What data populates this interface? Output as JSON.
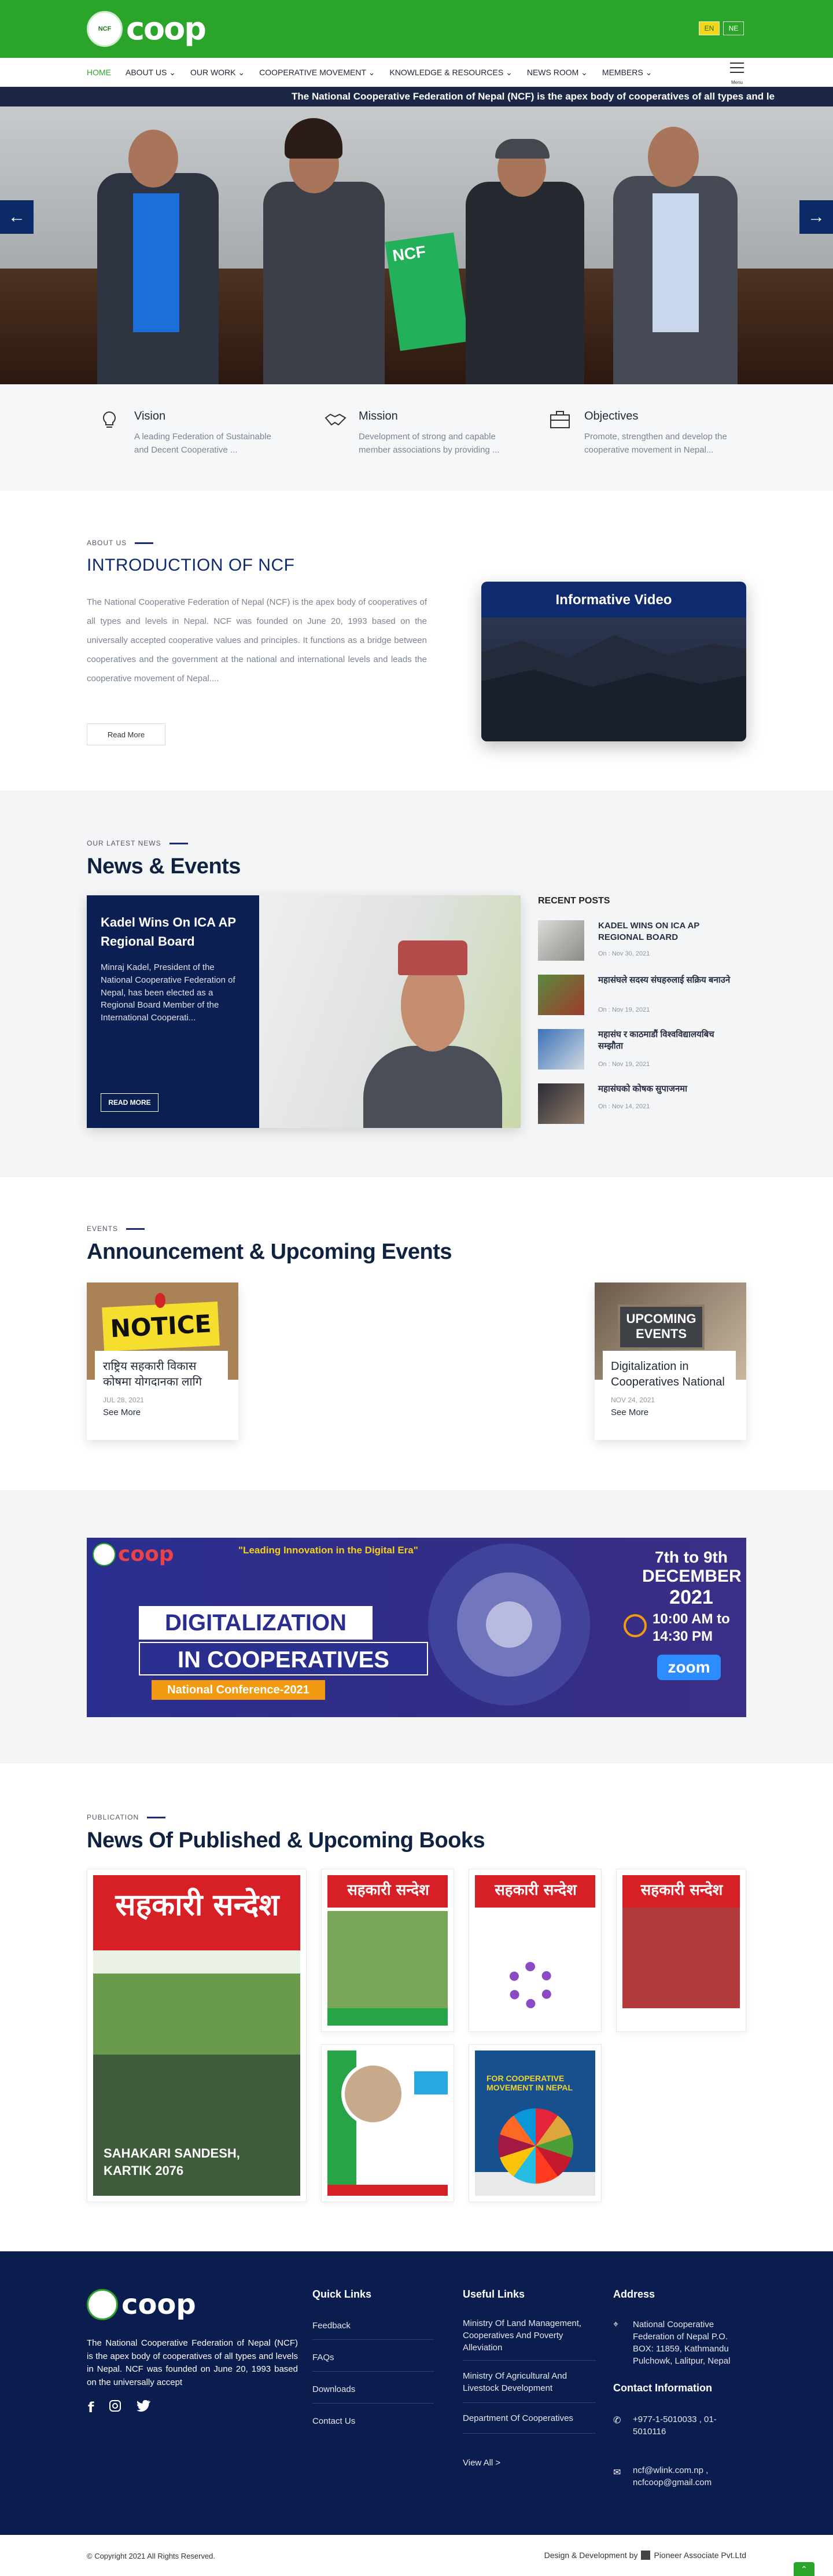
{
  "header": {
    "logo_seal_text": "NCF",
    "logo_text": "coop",
    "languages": [
      {
        "code": "EN",
        "active": true
      },
      {
        "code": "NE",
        "active": false
      }
    ],
    "nav": [
      {
        "label": "HOME",
        "active": true
      },
      {
        "label": "ABOUT US",
        "dropdown": true
      },
      {
        "label": "OUR WORK",
        "dropdown": true
      },
      {
        "label": "COOPERATIVE MOVEMENT",
        "dropdown": true
      },
      {
        "label": "KNOWLEDGE & RESOURCES",
        "dropdown": true
      },
      {
        "label": "NEWS ROOM",
        "dropdown": true
      },
      {
        "label": "MEMBERS",
        "dropdown": true
      }
    ],
    "menu_label": "Menu",
    "ticker": "The National Cooperative Federation of Nepal (NCF) is the apex body of cooperatives of all types and le"
  },
  "hero": {
    "prev_icon": "arrow-left-icon",
    "next_icon": "arrow-right-icon",
    "book_label": "NCF"
  },
  "vmo": [
    {
      "title": "Vision",
      "text": "A leading Federation of Sustainable and Decent Cooperative ...",
      "icon": "lightbulb-icon"
    },
    {
      "title": "Mission",
      "text": "Development of strong and capable member associations by providing ...",
      "icon": "handshake-icon"
    },
    {
      "title": "Objectives",
      "text": "Promote, strengthen and develop the cooperative movement in Nepal...",
      "icon": "briefcase-icon"
    }
  ],
  "about": {
    "eyebrow": "ABOUT US",
    "title": "INTRODUCTION OF NCF",
    "text": "The National Cooperative Federation of Nepal (NCF) is the apex body of cooperatives of all types and levels in Nepal. NCF was founded on June 20, 1993 based on the universally accepted cooperative values and principles. It functions as a bridge between cooperatives and the government at the national and international levels and leads the cooperative movement of Nepal....",
    "button": "Read More",
    "video_title": "Informative Video"
  },
  "news": {
    "eyebrow": "OUR LATEST NEWS",
    "title": "News & Events",
    "feature": {
      "title": "Kadel Wins On ICA AP Regional Board",
      "text": "Minraj Kadel, President of the National Cooperative Federation of Nepal, has been elected as a Regional Board Member of the International Cooperati...",
      "button": "READ MORE"
    },
    "recent_heading": "RECENT POSTS",
    "recent": [
      {
        "title": "KADEL WINS ON ICA AP REGIONAL BOARD",
        "date": "On : Nov 30, 2021"
      },
      {
        "title": "महासंघले सदस्य संघहरुलाई सक्रिय बनाउने",
        "date": "On : Nov 19, 2021"
      },
      {
        "title": "महासंघ र काठमाडौं विश्वविद्यालयबिच सम्झौता",
        "date": "On : Nov 19, 2021"
      },
      {
        "title": "महासंघको कोषक सुपाजनमा",
        "date": "On : Nov 14, 2021"
      }
    ]
  },
  "events": {
    "eyebrow": "EVENTS",
    "title": "Announcement & Upcoming Events",
    "items": [
      {
        "image_text": "NOTICE",
        "title": "राष्ट्रिय सहकारी विकास कोषमा योगदानका लागि",
        "date": "JUL 28, 2021",
        "more": "See More"
      },
      {
        "image_text": "UPCOMING EVENTS",
        "title": "Digitalization in Cooperatives National",
        "date": "NOV 24, 2021",
        "more": "See More"
      }
    ]
  },
  "banner": {
    "logo_text": "coop",
    "tagline": "\"Leading Innovation in the Digital Era\"",
    "line1": "DIGITALIZATION",
    "line2": "IN COOPERATIVES",
    "conf": "National Conference-2021",
    "dates": "7th to 9th",
    "month": "DECEMBER",
    "year": "2021",
    "time": "10:00 AM to 14:30 PM",
    "platform": "zoom",
    "colors": {
      "navy": "#2a2f8f",
      "orange": "#f29a12",
      "white": "#ffffff"
    }
  },
  "publication": {
    "eyebrow": "PUBLICATION",
    "title": "News Of Published & Upcoming Books",
    "featured": {
      "masthead": "सहकारी सन्देश",
      "caption": "SAHAKARI SANDESH, KARTIK 2076"
    },
    "books": [
      {
        "masthead": "सहकारी सन्देश"
      },
      {
        "masthead": "सहकारी सन्देश"
      },
      {
        "masthead": "सहकारी सन्देश"
      },
      {
        "masthead": ""
      },
      {
        "masthead": "",
        "label": "FOR COOPERATIVE MOVEMENT IN NEPAL"
      }
    ]
  },
  "footer": {
    "logo_text": "coop",
    "about": "The National Cooperative Federation of Nepal (NCF) is the apex body of cooperatives of all types and levels in Nepal. NCF was founded on June 20, 1993 based on the universally accept",
    "social": [
      "facebook-icon",
      "instagram-icon",
      "twitter-icon"
    ],
    "quick_links_title": "Quick Links",
    "quick_links": [
      "Feedback",
      "FAQs",
      "Downloads",
      "Contact Us"
    ],
    "useful_links_title": "Useful Links",
    "useful_links": [
      "Ministry Of Land Management, Cooperatives And Poverty Alleviation",
      "Ministry Of Agricultural And Livestock Development",
      "Department Of Cooperatives"
    ],
    "view_all": "View All >",
    "address_title": "Address",
    "address": "National Cooperative Federation of Nepal P.O. BOX: 11859, Kathmandu Pulchowk, Lalitpur, Nepal",
    "contact_title": "Contact Information",
    "phone": "+977-1-5010033 , 01-5010116",
    "email": "ncf@wlink.com.np , ncfcoop@gmail.com"
  },
  "copyright": {
    "left": "© Copyright 2021 All Rights Reserved.",
    "right_prefix": "Design & Development by",
    "right_company": "Pioneer Associate Pvt.Ltd"
  }
}
